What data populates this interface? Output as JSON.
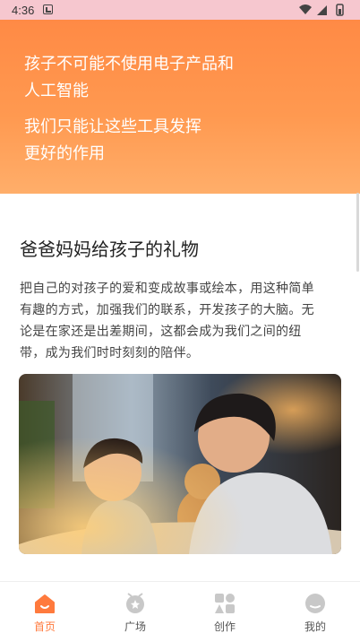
{
  "status_bar": {
    "time": "4:36"
  },
  "hero": {
    "line1": "孩子不可能不使用电子产品和",
    "line2": "人工智能",
    "line3": "我们只能让这些工具发挥",
    "line4": "更好的作用"
  },
  "article": {
    "title": "爸爸妈妈给孩子的礼物",
    "body_lines": [
      "把自己的对孩子的爱和变成故事或绘本，用这种简单",
      "有趣的方式，加强我们的联系，开发孩子的大脑。无",
      "论是在家还是出差期间，这都会成为我们之间的纽",
      "带，成为我们时时刻刻的陪伴。"
    ]
  },
  "tabbar": {
    "items": [
      {
        "label": "首页",
        "icon": "home-icon",
        "active": true
      },
      {
        "label": "广场",
        "icon": "plaza-icon",
        "active": false
      },
      {
        "label": "创作",
        "icon": "create-icon",
        "active": false
      },
      {
        "label": "我的",
        "icon": "profile-icon",
        "active": false
      }
    ]
  },
  "colors": {
    "accent": "#ff7a3d",
    "hero_top": "#ff8a45",
    "hero_bottom": "#ffae6a",
    "status_bar": "#f6c7cf"
  }
}
